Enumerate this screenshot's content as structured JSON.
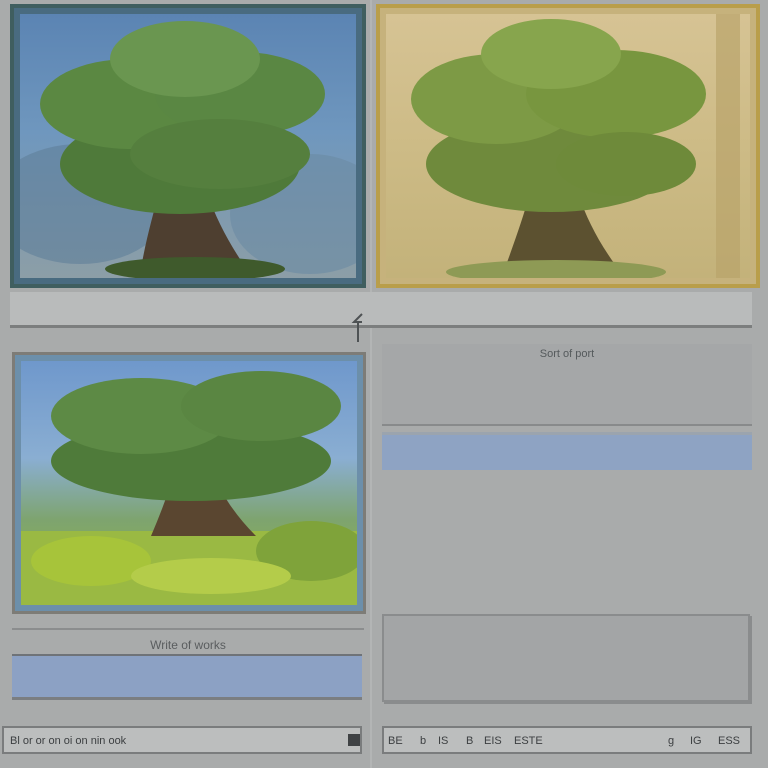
{
  "splitter": {
    "icon": "split-arrow-icon"
  },
  "right_header": {
    "title": "Sort of port"
  },
  "left_caption": {
    "label": "Write of works"
  },
  "status_left": {
    "text": "Bl or or on oi on nin ook",
    "marker": "Bl",
    "button_icon": "square-icon"
  },
  "status_right": {
    "items": [
      "BE",
      "b",
      "IS",
      "B",
      "EIS",
      "ESTE"
    ],
    "right_items": [
      "g",
      "IG",
      "ESS"
    ]
  },
  "colors": {
    "background": "#a9abab",
    "frame_teal": "#3f5e5f",
    "frame_gold": "#b99e4a",
    "band_blue": "#8ca1c4"
  },
  "images": [
    {
      "name": "tree-painting-blue",
      "icon": "image-icon"
    },
    {
      "name": "tree-painting-sepia",
      "icon": "image-icon"
    },
    {
      "name": "tree-painting-meadow",
      "icon": "image-icon"
    }
  ]
}
